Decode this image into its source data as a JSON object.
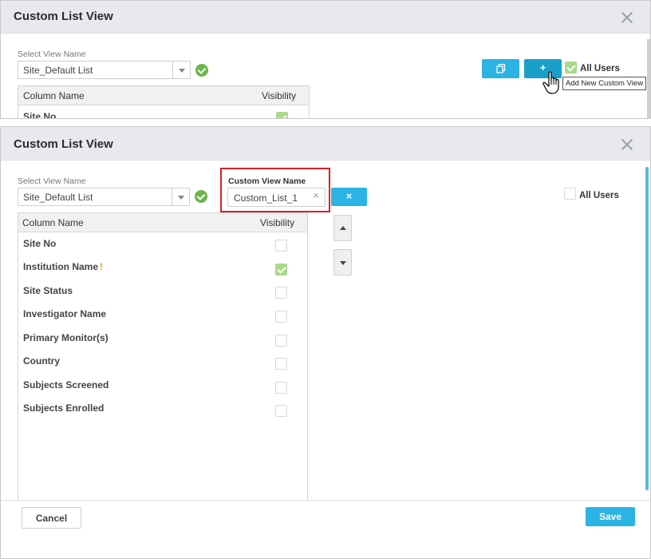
{
  "top": {
    "title": "Custom List View",
    "select_label": "Select View Name",
    "select_value": "Site_Default List",
    "col_header_name": "Column Name",
    "col_header_visibility": "Visibility",
    "first_row": "Site No",
    "copy_icon": "copy-icon",
    "add_label": "+",
    "all_users_label": "All Users",
    "all_users_checked": true,
    "tooltip": "Add New Custom View"
  },
  "bottom": {
    "title": "Custom List View",
    "select_label": "Select View Name",
    "select_value": "Site_Default List",
    "custom_view_label": "Custom View Name",
    "custom_view_value": "Custom_List_1",
    "clear_glyph": "×",
    "cancel_new_glyph": "×",
    "all_users_label": "All Users",
    "all_users_checked": false,
    "col_header_name": "Column Name",
    "col_header_visibility": "Visibility",
    "rows": [
      {
        "label": "Site No",
        "visible": false
      },
      {
        "label": "Institution Name",
        "visible": true,
        "warning": "!"
      },
      {
        "label": "Site Status",
        "visible": false
      },
      {
        "label": "Investigator Name",
        "visible": false
      },
      {
        "label": "Primary Monitor(s)",
        "visible": false
      },
      {
        "label": "Country",
        "visible": false
      },
      {
        "label": "Subjects Screened",
        "visible": false
      },
      {
        "label": "Subjects Enrolled",
        "visible": false
      }
    ],
    "cancel_label": "Cancel",
    "save_label": "Save"
  },
  "colors": {
    "accent": "#2bb3e3",
    "accent_dark": "#1a9fc8",
    "ok_green": "#6bb64a",
    "check_green": "#a9d98a",
    "highlight_red": "#d9212a"
  }
}
